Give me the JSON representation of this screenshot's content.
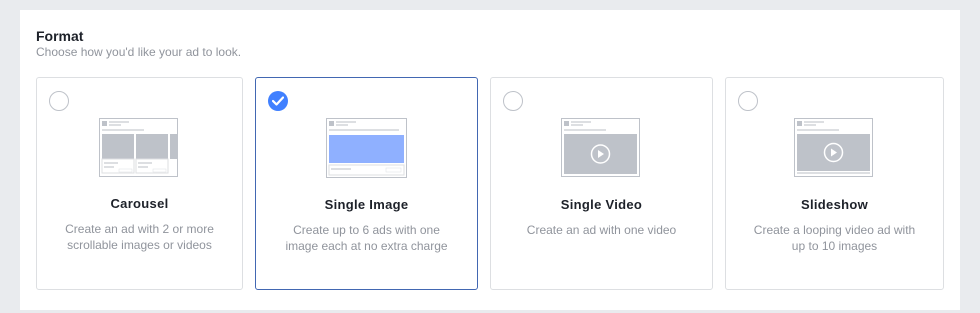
{
  "section": {
    "title": "Format",
    "subtitle": "Choose how you'd like your ad to look."
  },
  "cards": [
    {
      "title": "Carousel",
      "description": "Create an ad with 2 or more scrollable images or videos",
      "selected": false,
      "icon": "carousel-preview-icon"
    },
    {
      "title": "Single Image",
      "description": "Create up to 6 ads with one image each at no extra charge",
      "selected": true,
      "icon": "single-image-preview-icon"
    },
    {
      "title": "Single Video",
      "description": "Create an ad with one video",
      "selected": false,
      "icon": "single-video-preview-icon"
    },
    {
      "title": "Slideshow",
      "description": "Create a looping video ad with up to 10 images",
      "selected": false,
      "icon": "slideshow-preview-icon"
    }
  ],
  "colors": {
    "accent": "#4080ff",
    "selected_border": "#4267b2",
    "image_fill": "#8fb0ff",
    "placeholder": "#bec2c9"
  }
}
